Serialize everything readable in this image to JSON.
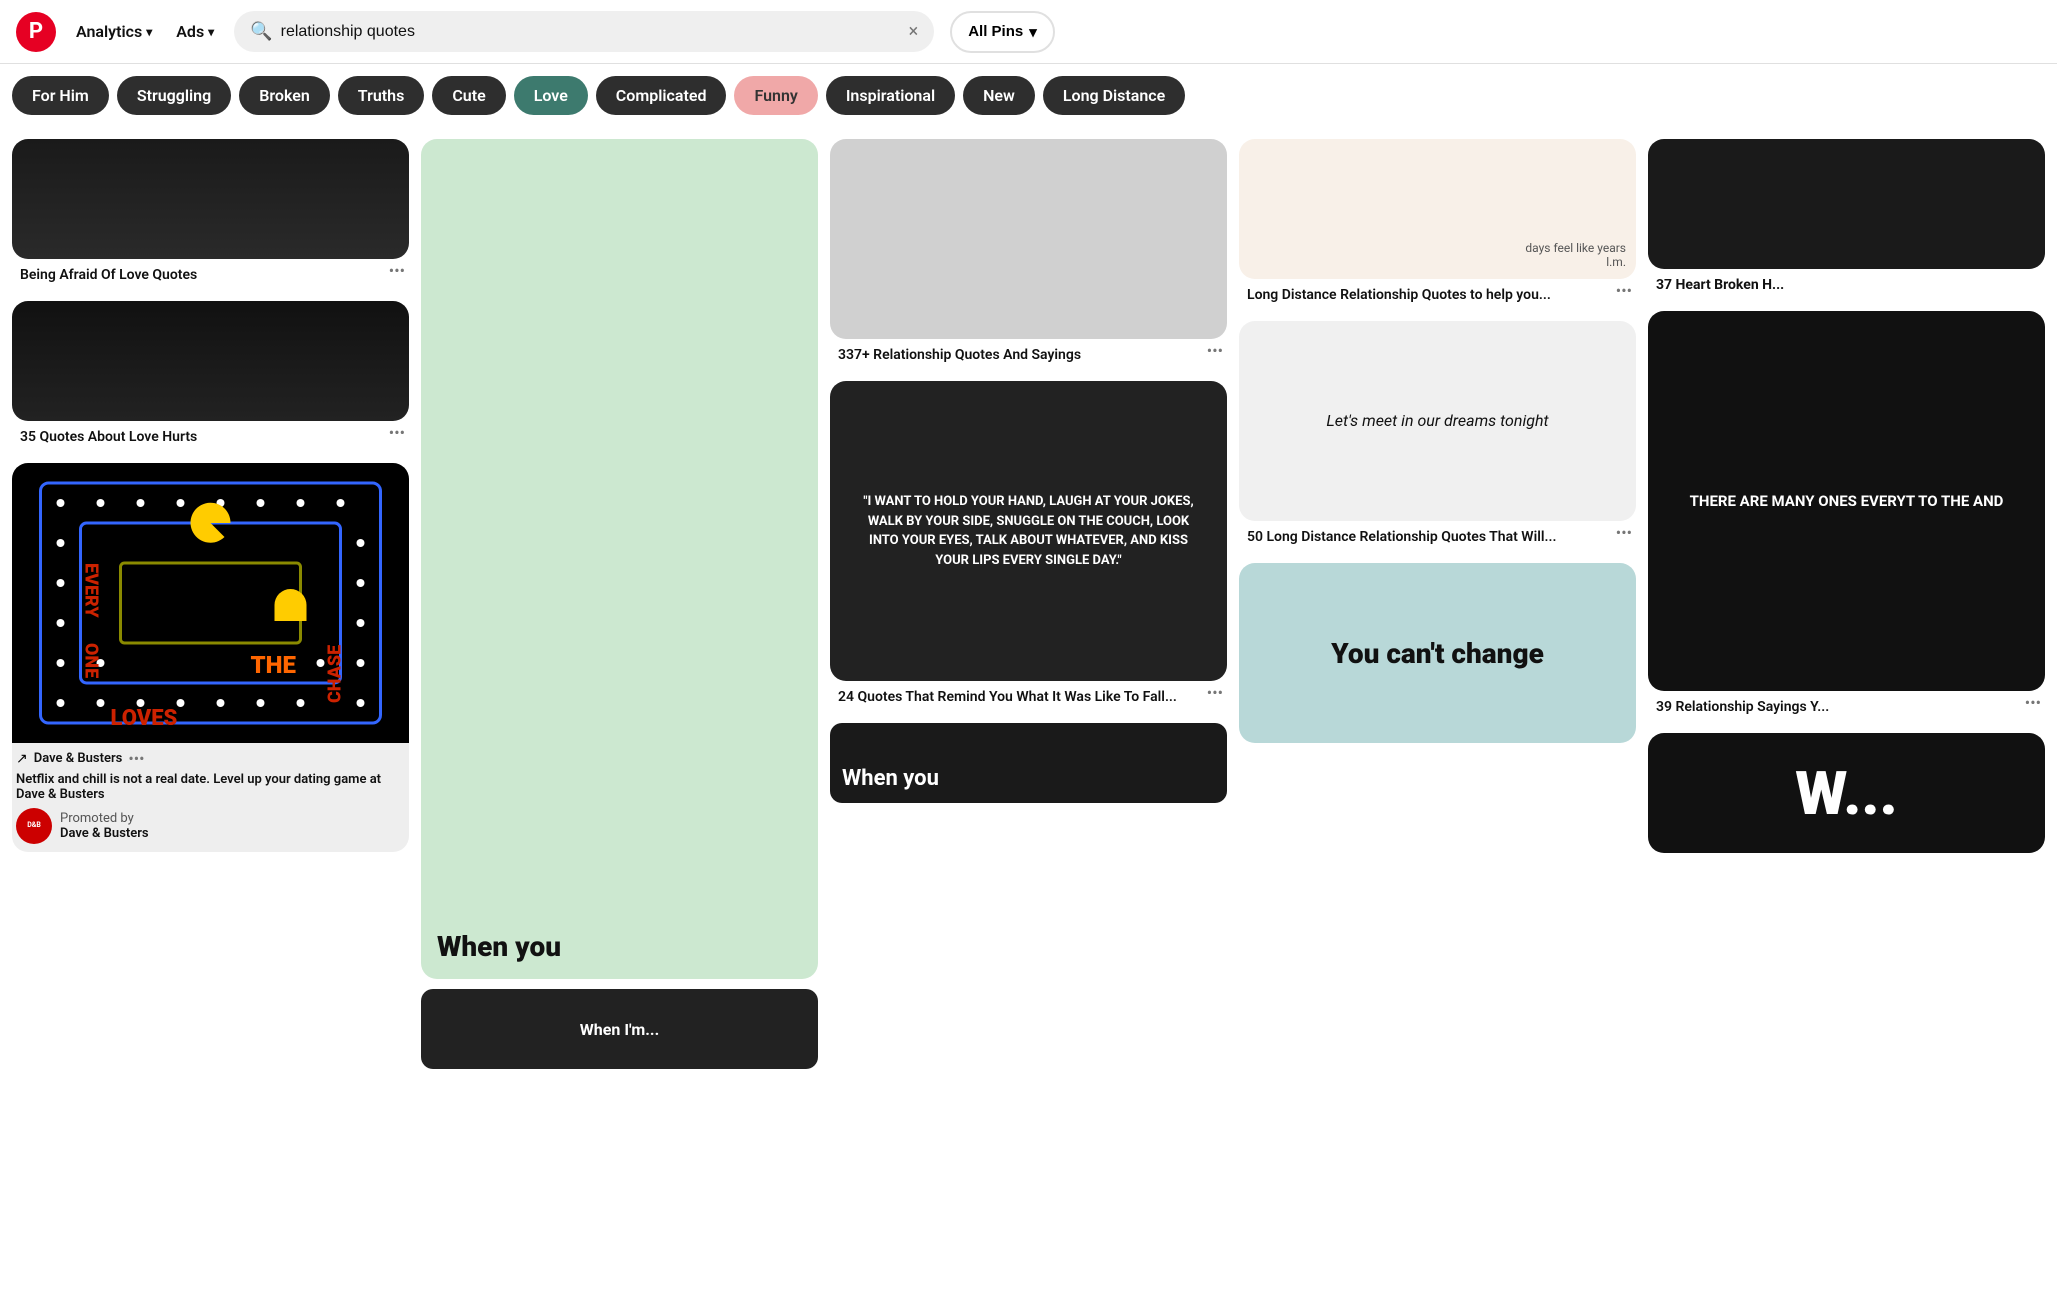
{
  "header": {
    "logo_char": "P",
    "nav": [
      {
        "label": "Analytics",
        "has_chevron": true
      },
      {
        "label": "Ads",
        "has_chevron": true
      }
    ],
    "search": {
      "placeholder": "Search",
      "value": "relationship quotes",
      "clear_label": "×"
    },
    "all_pins": "All Pins"
  },
  "filters": [
    {
      "label": "For Him",
      "active": false
    },
    {
      "label": "Struggling",
      "active": false
    },
    {
      "label": "Broken",
      "active": false
    },
    {
      "label": "Truths",
      "active": false
    },
    {
      "label": "Cute",
      "active": false
    },
    {
      "label": "Love",
      "active": false,
      "teal": true
    },
    {
      "label": "Complicated",
      "active": false
    },
    {
      "label": "Funny",
      "active": true
    },
    {
      "label": "Inspirational",
      "active": false
    },
    {
      "label": "New",
      "active": false
    },
    {
      "label": "Long Distance",
      "active": false
    }
  ],
  "pins": {
    "col1": [
      {
        "id": "being-afraid",
        "title": "Being Afraid Of Love Quotes",
        "has_more": true
      },
      {
        "id": "love-hurts",
        "title": "35 Quotes About Love Hurts",
        "has_more": true
      },
      {
        "id": "pacman-ad",
        "title": "",
        "ad_brand": "Dave & Busters",
        "ad_desc": "Netflix and chill is not a real date. Level up your dating game at Dave & Busters",
        "promoted_by": "Promoted by",
        "promoted_name": "Dave & Busters",
        "has_more": true
      }
    ],
    "col2": [
      {
        "id": "when-you",
        "title": "When you",
        "has_more": false
      }
    ],
    "col3": [
      {
        "id": "relationship-sayings",
        "title": "337+ Relationship Quotes And Sayings",
        "has_more": true
      },
      {
        "id": "hold-hand",
        "title": "24 Quotes That Remind You What It Was Like To Fall...",
        "has_more": true
      },
      {
        "id": "when-you-2",
        "title": "When you",
        "has_more": false
      }
    ],
    "col4": [
      {
        "id": "long-dist-1",
        "title": "Long Distance Relationship Quotes to help you...",
        "has_more": true
      },
      {
        "id": "meet-in-dreams",
        "title": "50 Long Distance Relationship Quotes That Will...",
        "has_more": true
      },
      {
        "id": "you-cant",
        "title": "You can't change",
        "has_more": false
      }
    ],
    "col5": [
      {
        "id": "37-heart",
        "title": "37 Heart Broken H...",
        "has_more": false
      },
      {
        "id": "far-quote",
        "title": "39 Relationship Sayings Y...",
        "has_more": true
      },
      {
        "id": "w-partial",
        "title": "W...",
        "has_more": false
      }
    ]
  },
  "quotes": {
    "hand_quote": "\"I WANT TO HOLD YOUR HAND, LAUGH AT YOUR JOKES, WALK BY YOUR SIDE, SNUGGLE ON THE COUCH, LOOK INTO YOUR EYES, TALK ABOUT WHATEVER, AND KISS YOUR LIPS EVERY SINGLE DAY.\"",
    "meet_dreams": "Let's meet in our dreams tonight",
    "you_cant": "You can't change",
    "everyone_loves": "EVERYONE LOVES THE CHASE",
    "days_feel": "days feel like years",
    "lm_sig": "l.m.",
    "far_quote": "THERE ARE MANY ONES EVERYT TO THE AND"
  },
  "promoted": {
    "logo_text": "D&B",
    "brand": "Dave & Busters",
    "label": "Promoted by"
  }
}
